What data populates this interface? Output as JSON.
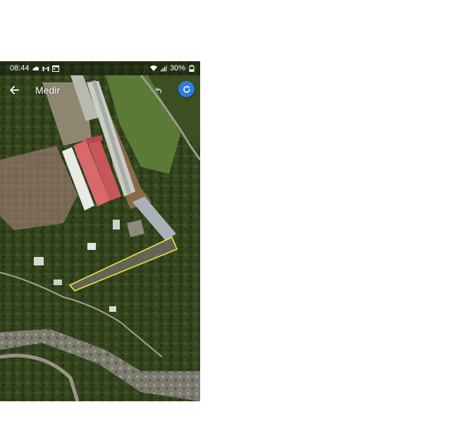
{
  "status_bar": {
    "time": "08:44",
    "battery": "30%",
    "left_icons": [
      "cloud-icon",
      "gmail-icon",
      "calendar-icon"
    ],
    "right_icons": [
      "wifi-icon",
      "signal-icon",
      "battery-icon"
    ]
  },
  "app_bar": {
    "title": "Medir",
    "icons": [
      "back-arrow-icon",
      "undo-icon",
      "reset-icon"
    ],
    "accent_color": "#2f7be6"
  },
  "map": {
    "view": "satellite",
    "measure_polygon_color": "#f2e23a"
  }
}
